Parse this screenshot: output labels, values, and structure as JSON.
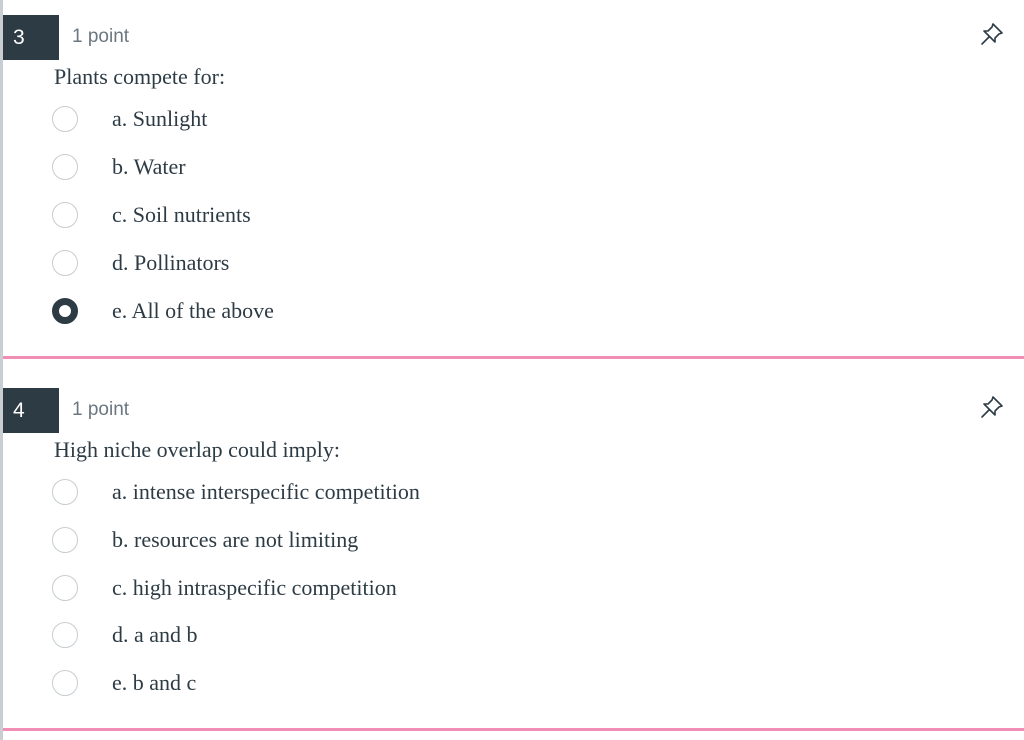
{
  "questions": [
    {
      "number": "3",
      "points": "1 point",
      "prompt": "Plants compete for:",
      "answers": [
        {
          "label": "a. Sunlight",
          "selected": false
        },
        {
          "label": "b. Water",
          "selected": false
        },
        {
          "label": "c. Soil nutrients",
          "selected": false
        },
        {
          "label": "d. Pollinators",
          "selected": false
        },
        {
          "label": "e. All of the above",
          "selected": true
        }
      ]
    },
    {
      "number": "4",
      "points": "1 point",
      "prompt": "High niche overlap could imply:",
      "answers": [
        {
          "label": "a. intense interspecific competition",
          "selected": false
        },
        {
          "label": "b. resources are not limiting",
          "selected": false
        },
        {
          "label": "c. high intraspecific competition",
          "selected": false
        },
        {
          "label": "d. a and b",
          "selected": false
        },
        {
          "label": "e. b and c",
          "selected": false
        }
      ]
    }
  ],
  "colors": {
    "header_bg": "#2d3b45",
    "divider": "#f08eb6",
    "text": "#2d3b45",
    "muted": "#6b7780"
  },
  "icons": {
    "pin": "pushpin-icon"
  }
}
